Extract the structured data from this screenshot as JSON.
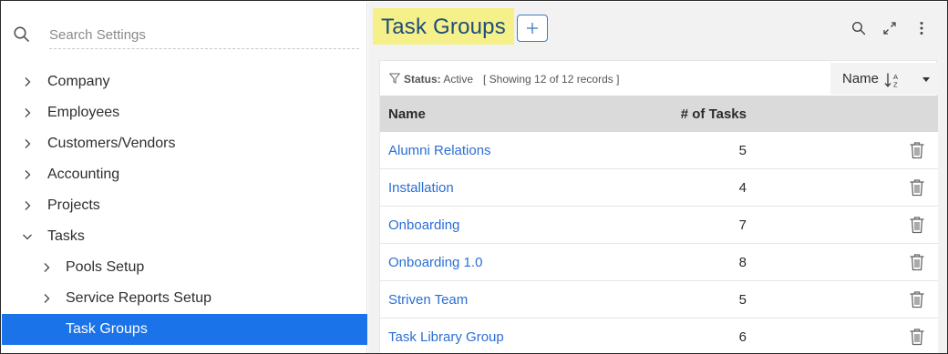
{
  "sidebar": {
    "search_placeholder": "Search Settings",
    "items": [
      {
        "label": "Company",
        "level": 0,
        "state": "collapsed"
      },
      {
        "label": "Employees",
        "level": 0,
        "state": "collapsed"
      },
      {
        "label": "Customers/Vendors",
        "level": 0,
        "state": "collapsed"
      },
      {
        "label": "Accounting",
        "level": 0,
        "state": "collapsed"
      },
      {
        "label": "Projects",
        "level": 0,
        "state": "collapsed"
      },
      {
        "label": "Tasks",
        "level": 0,
        "state": "expanded"
      },
      {
        "label": "Pools Setup",
        "level": 1,
        "state": "collapsed"
      },
      {
        "label": "Service Reports Setup",
        "level": 1,
        "state": "collapsed"
      },
      {
        "label": "Task Groups",
        "level": 1,
        "state": "selected"
      }
    ]
  },
  "header": {
    "title": "Task Groups",
    "add_icon": "plus-icon",
    "icons": [
      "search-icon",
      "expand-icon",
      "more-vertical-icon"
    ]
  },
  "filter": {
    "status_label": "Status:",
    "status_value": "Active",
    "showing": "[ Showing 12 of 12 records ]"
  },
  "sort": {
    "label": "Name",
    "icon": "sort-alpha-icon"
  },
  "table": {
    "columns": [
      "Name",
      "# of Tasks"
    ],
    "rows": [
      {
        "name": "Alumni Relations",
        "tasks": "5"
      },
      {
        "name": "Installation",
        "tasks": "4"
      },
      {
        "name": "Onboarding",
        "tasks": "7"
      },
      {
        "name": "Onboarding 1.0",
        "tasks": "8"
      },
      {
        "name": "Striven Team",
        "tasks": "5"
      },
      {
        "name": "Task Library Group",
        "tasks": "6"
      }
    ]
  },
  "colors": {
    "accent": "#1a73e8",
    "link": "#2a6fd4",
    "title_highlight": "#f5f08a",
    "title_text": "#1d4d7a"
  }
}
